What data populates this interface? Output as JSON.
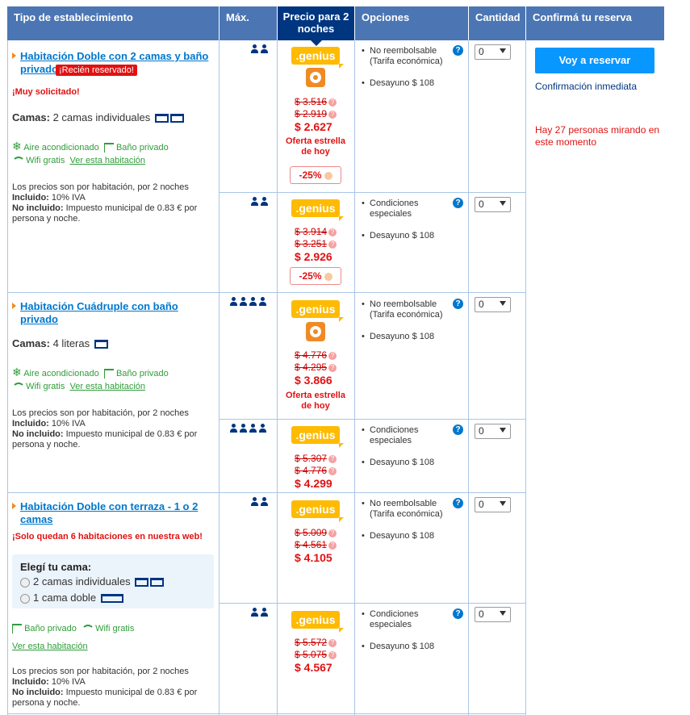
{
  "headers": {
    "tipo": "Tipo de establecimiento",
    "max": "Máx.",
    "precio": "Precio para 2 noches",
    "opciones": "Opciones",
    "cantidad": "Cantidad",
    "confirma": "Confirmá tu reserva"
  },
  "reserve": {
    "button": "Voy a reservar",
    "confirmation": "Confirmación inmediata",
    "watching": "Hay 27 personas mirando en este momento"
  },
  "common": {
    "genius": ".genius",
    "deal": "Oferta estrella de hoy",
    "aire": "Aire acondicionado",
    "bano": "Baño privado",
    "wifi": "Wifi gratis",
    "ver": "Ver esta habitación",
    "camas_label": "Camas:",
    "precios_text": "Los precios son por habitación, por 2 noches",
    "incluido_label": "Incluido:",
    "incluido_val": "10% IVA",
    "noincl_label": "No incluido:",
    "noincl_val": "Impuesto municipal de 0.83 € por persona y noche.",
    "desayuno": "Desayuno $ 108",
    "no_reemb": "No reembolsable (Tarifa económica)",
    "cond": "Condiciones especiales",
    "qty": "0",
    "help": "?",
    "q": "?"
  },
  "room1": {
    "name": "Habitación Doble con 2 camas y baño privado",
    "badge": "¡Recién reservado!",
    "popular": "¡Muy solicitado!",
    "camas": "2 camas individuales",
    "r1": {
      "old1": "$ 3.516",
      "old2": "$ 2.919",
      "new": "$ 2.627",
      "pct": "-25%"
    },
    "r2": {
      "old1": "$ 3.914",
      "old2": "$ 3.251",
      "new": "$ 2.926",
      "pct": "-25%"
    }
  },
  "room2": {
    "name": "Habitación Cuádruple con baño privado",
    "camas": "4 literas",
    "r1": {
      "old1": "$ 4.776",
      "old2": "$ 4.295",
      "new": "$ 3.866"
    },
    "r2": {
      "old1": "$ 5.307",
      "old2": "$ 4.776",
      "new": "$ 4.299"
    }
  },
  "room3": {
    "name": "Habitación Doble con terraza - 1 o 2 camas",
    "scarce": "¡Solo quedan 6 habitaciones en nuestra web!",
    "elegi": "Elegí tu cama:",
    "opt1": "2 camas individuales",
    "opt2": "1 cama doble",
    "r1": {
      "old1": "$ 5.009",
      "old2": "$ 4.561",
      "new": "$ 4.105"
    },
    "r2": {
      "old1": "$ 5.572",
      "old2": "$ 5.075",
      "new": "$ 4.567"
    }
  }
}
